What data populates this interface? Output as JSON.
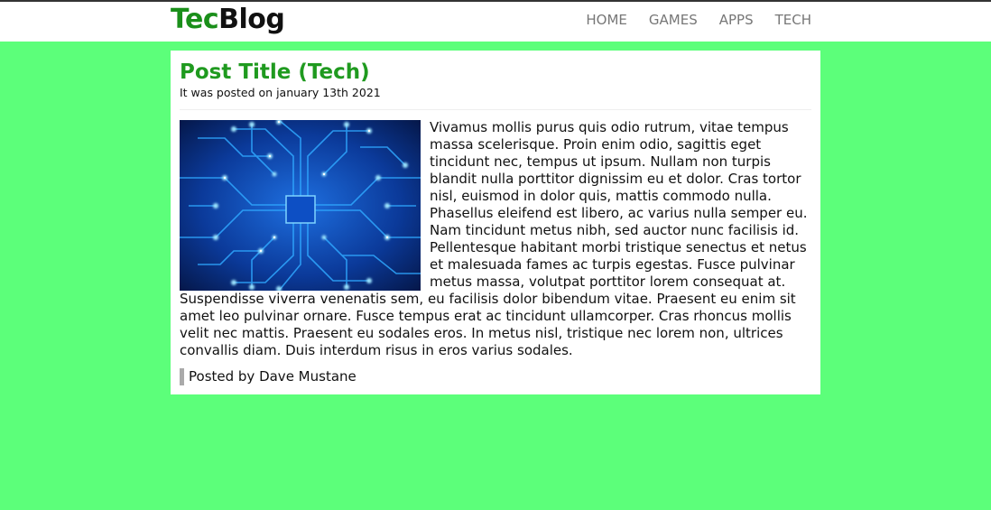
{
  "logo": {
    "part1": "Tec",
    "part2": "Blog"
  },
  "nav": {
    "home": "HOME",
    "games": "GAMES",
    "apps": "APPS",
    "tech": "TECH"
  },
  "post": {
    "title": "Post Title (Tech)",
    "date": "It was posted on january 13th 2021",
    "image_icon": "circuit-board-image",
    "body": "Vivamus mollis purus quis odio rutrum, vitae tempus massa scelerisque. Proin enim odio, sagittis eget tincidunt nec, tempus ut ipsum. Nullam non turpis blandit nulla porttitor dignissim eu et dolor. Cras tortor nisl, euismod in dolor quis, mattis commodo nulla. Phasellus eleifend est libero, ac varius nulla semper eu. Nam tincidunt metus nibh, sed auctor nunc facilisis id. Pellentesque habitant morbi tristique senectus et netus et malesuada fames ac turpis egestas. Fusce pulvinar metus massa, volutpat porttitor lorem consequat at. Suspendisse viverra venenatis sem, eu facilisis dolor bibendum vitae. Praesent eu enim sit amet leo pulvinar ornare. Fusce tempus erat ac tincidunt ullamcorper. Cras rhoncus mollis velit nec mattis. Praesent eu sodales eros. In metus nisl, tristique nec lorem non, ultrices convallis diam. Duis interdum risus in eros varius sodales.",
    "byline": "Posted by Dave Mustane"
  },
  "colors": {
    "page_background": "#5cff7a",
    "brand_green": "#1a8f1a",
    "title_green": "#1f9a1f",
    "nav_gray": "#777777"
  }
}
